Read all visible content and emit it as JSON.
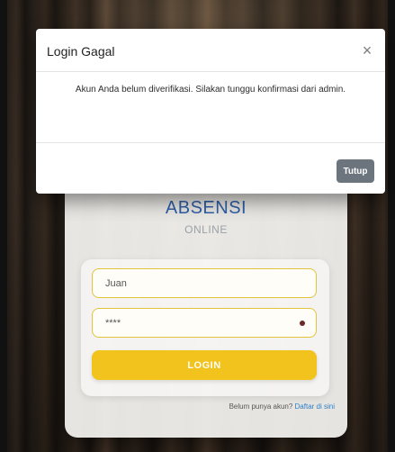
{
  "modal": {
    "title": "Login Gagal",
    "message": "Akun Anda belum diverifikasi. Silakan tunggu konfirmasi dari admin.",
    "close_icon": "close-icon",
    "close_button_label": "Tutup"
  },
  "login": {
    "title": "ABSENSI",
    "subtitle": "ONLINE",
    "username_value": "Juan",
    "password_value": "****",
    "button_label": "LOGIN",
    "register_prompt": "Belum punya akun?",
    "register_link": "Daftar di sini"
  },
  "colors": {
    "accent_blue": "#2f5fa8",
    "button_yellow": "#f2c21d",
    "field_border": "#e3c33a",
    "secondary_button": "#6c757d"
  }
}
